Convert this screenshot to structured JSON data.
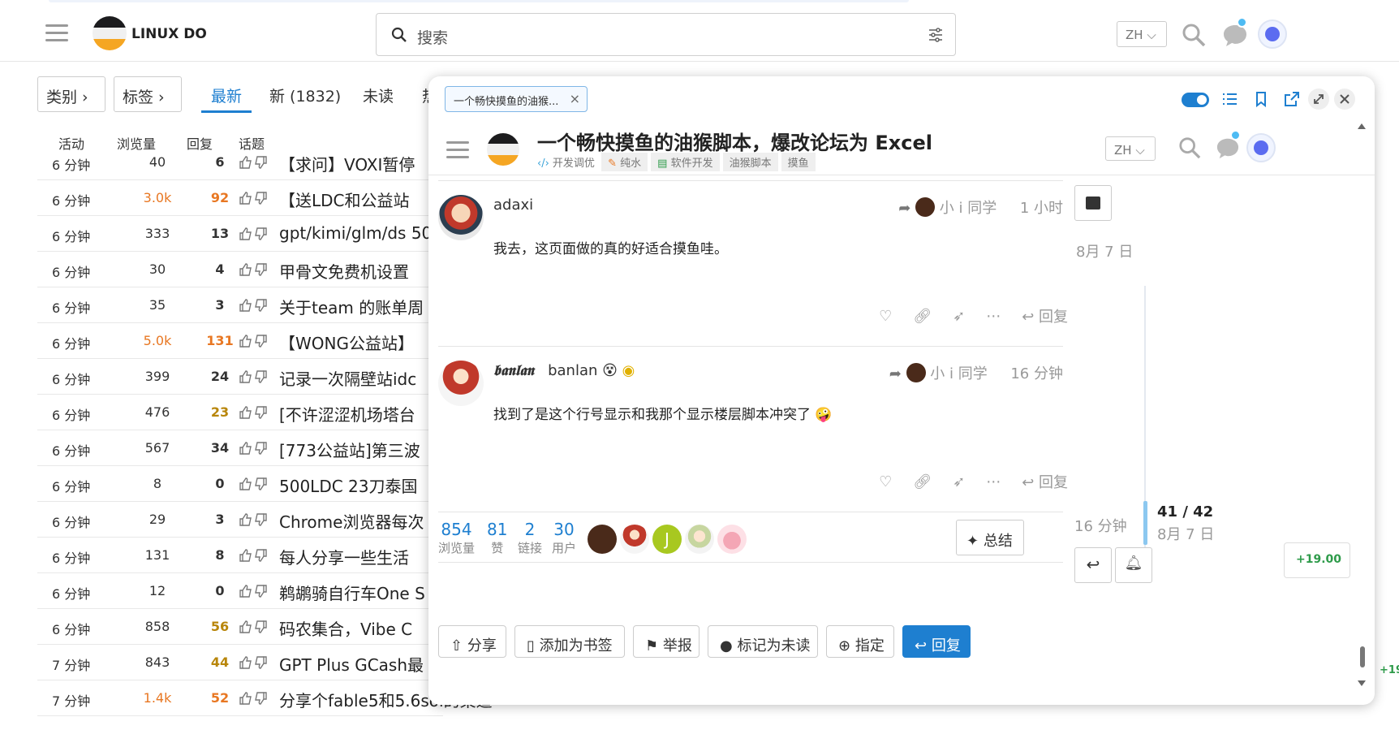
{
  "header": {
    "site_name": "LINUX DO",
    "search_placeholder": "搜索",
    "lang": "ZH"
  },
  "nav": {
    "category_btn": "类别",
    "tags_btn": "标签",
    "tabs": [
      "最新",
      "新 (1832)",
      "未读",
      "热"
    ],
    "active_tab": "最新"
  },
  "columns": [
    "活动",
    "浏览量",
    "回复",
    "话题"
  ],
  "topics": [
    {
      "activity": "6 分钟",
      "views": "40",
      "replies": "6",
      "title": "【求问】VOXI暂停",
      "heat": ""
    },
    {
      "activity": "6 分钟",
      "views": "3.0k",
      "replies": "92",
      "title": "【送LDC和公益站",
      "heat": "hot"
    },
    {
      "activity": "6 分钟",
      "views": "333",
      "replies": "13",
      "title": "gpt/kimi/glm/ds 50",
      "heat": ""
    },
    {
      "activity": "6 分钟",
      "views": "30",
      "replies": "4",
      "title": "甲骨文免费机设置",
      "heat": ""
    },
    {
      "activity": "6 分钟",
      "views": "35",
      "replies": "3",
      "title": "关于team 的账单周",
      "heat": ""
    },
    {
      "activity": "6 分钟",
      "views": "5.0k",
      "replies": "131",
      "title": "【WONG公益站】",
      "heat": "hot"
    },
    {
      "activity": "6 分钟",
      "views": "399",
      "replies": "24",
      "title": "记录一次隔壁站idc",
      "heat": ""
    },
    {
      "activity": "6 分钟",
      "views": "476",
      "replies": "23",
      "title": "[不许涩涩机场塔台",
      "heat": "warm"
    },
    {
      "activity": "6 分钟",
      "views": "567",
      "replies": "34",
      "title": "[773公益站]第三波",
      "heat": ""
    },
    {
      "activity": "6 分钟",
      "views": "8",
      "replies": "0",
      "title": "500LDC 23刀泰国",
      "heat": ""
    },
    {
      "activity": "6 分钟",
      "views": "29",
      "replies": "3",
      "title": "Chrome浏览器每次",
      "heat": ""
    },
    {
      "activity": "6 分钟",
      "views": "131",
      "replies": "8",
      "title": "每人分享一些生活",
      "heat": ""
    },
    {
      "activity": "6 分钟",
      "views": "12",
      "replies": "0",
      "title": "鹈鹕骑自行车One S",
      "heat": ""
    },
    {
      "activity": "6 分钟",
      "views": "858",
      "replies": "56",
      "title": "码农集合，Vibe C",
      "heat": "warm"
    },
    {
      "activity": "7 分钟",
      "views": "843",
      "replies": "44",
      "title": "GPT Plus GCash最",
      "heat": "warm"
    },
    {
      "activity": "7 分钟",
      "views": "1.4k",
      "replies": "52",
      "title": "分享个fable5和5.6sol的渠道",
      "heat": "hot"
    }
  ],
  "panel": {
    "tab_label": "一个畅快摸鱼的油猴...",
    "topic_title": "一个畅快摸鱼的油猴脚本，爆改论坛为 Excel",
    "category": "开发调优",
    "tags": [
      "纯水",
      "软件开发",
      "油猴脚本",
      "摸鱼"
    ],
    "lang": "ZH"
  },
  "posts": [
    {
      "username": "adaxi",
      "display_name": "",
      "reply_to": "小 i 同学",
      "time": "1 小时",
      "body": "我去，这页面做的真的好适合摸鱼哇。",
      "reply_label": "回复"
    },
    {
      "username": "banlan",
      "display_name": "𝖇𝖆𝖓𝖑𝖆𝖓",
      "reply_to": "小 i 同学",
      "time": "16 分钟",
      "body": "找到了是这个行号显示和我那个显示楼层脚本冲突了",
      "reply_label": "回复"
    }
  ],
  "stats": [
    {
      "n": "854",
      "label": "浏览量"
    },
    {
      "n": "81",
      "label": "赞"
    },
    {
      "n": "2",
      "label": "链接"
    },
    {
      "n": "30",
      "label": "用户"
    }
  ],
  "summary_label": "总结",
  "bottom_buttons": [
    "分享",
    "添加为书签",
    "举报",
    "标记为未读",
    "指定",
    "回复"
  ],
  "timeline": {
    "top_date": "8月 7 日",
    "position": "41 / 42",
    "position_date": "8月 7 日",
    "bottom_label": "16 分钟",
    "credit": "+19.00",
    "edge_credit": "+19"
  },
  "colors": {
    "accent": "#1e7fd0",
    "hot": "#e87722",
    "credit_green": "#2e9b4a"
  }
}
